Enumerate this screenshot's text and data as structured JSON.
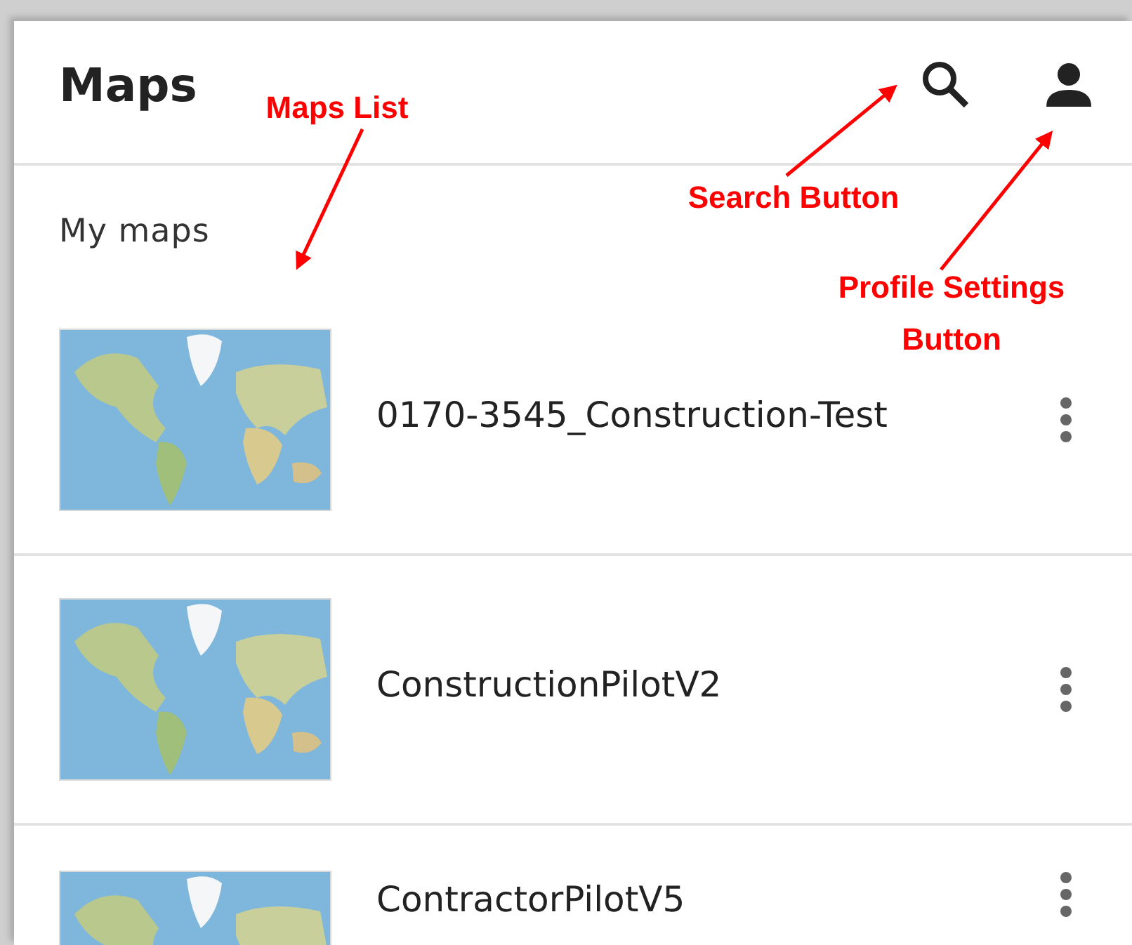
{
  "header": {
    "title": "Maps"
  },
  "section_label": "My maps",
  "maps": [
    {
      "title": "0170-3545_Construction-Test"
    },
    {
      "title": "ConstructionPilotV2"
    },
    {
      "title": "ContractorPilotV5"
    }
  ],
  "annotations": [
    {
      "text": "Maps List"
    },
    {
      "text": "Search Button"
    },
    {
      "text": "Profile Settings Button"
    }
  ]
}
